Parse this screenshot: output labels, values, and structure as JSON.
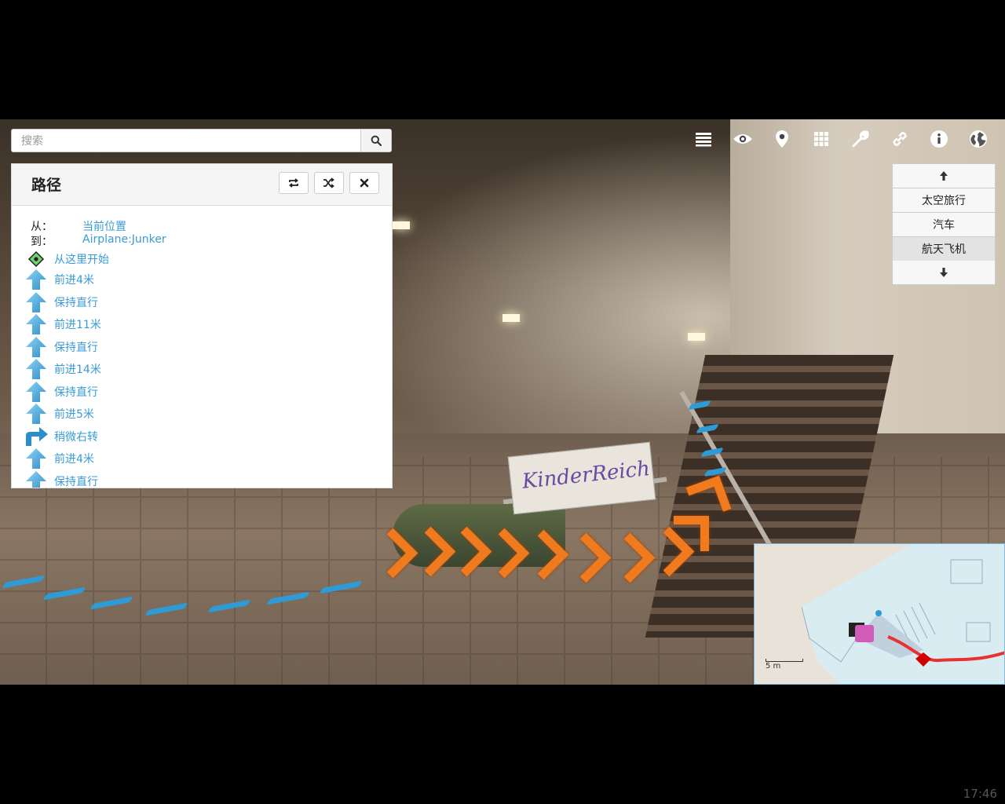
{
  "search": {
    "placeholder": "搜索"
  },
  "route": {
    "title": "路径",
    "from_label": "从：",
    "from_value": "当前位置",
    "to_label": "到：",
    "to_value": "Airplane:Junker",
    "steps": [
      {
        "icon": "start-pin-icon",
        "text": "从这里开始"
      },
      {
        "icon": "arrow-up-icon",
        "text": "前进4米"
      },
      {
        "icon": "arrow-up-icon",
        "text": "保持直行"
      },
      {
        "icon": "arrow-up-icon",
        "text": "前进11米"
      },
      {
        "icon": "arrow-up-icon",
        "text": "保持直行"
      },
      {
        "icon": "arrow-up-icon",
        "text": "前进14米"
      },
      {
        "icon": "arrow-up-icon",
        "text": "保持直行"
      },
      {
        "icon": "arrow-up-icon",
        "text": "前进5米"
      },
      {
        "icon": "turn-right-icon",
        "text": "稍微右转"
      },
      {
        "icon": "arrow-up-icon",
        "text": "前进4米"
      },
      {
        "icon": "arrow-up-icon",
        "text": "保持直行"
      }
    ]
  },
  "categories": {
    "items": [
      "太空旅行",
      "汽车",
      "航天飞机"
    ],
    "active": "航天飞机"
  },
  "toolbar_icons": [
    "list-icon",
    "eye-icon",
    "map-pin-icon",
    "grid-icon",
    "wrench-icon",
    "link-icon",
    "info-icon",
    "globe-icon"
  ],
  "scene": {
    "banner_text": "KinderReich"
  },
  "minimap": {
    "scale_label": "5 m"
  },
  "clock": "17:46",
  "colors": {
    "link": "#3a9bd4",
    "route_line": "#e83232",
    "nav_arrow_orange": "#f07a1e",
    "nav_arrow_blue": "#2e9bd6"
  }
}
